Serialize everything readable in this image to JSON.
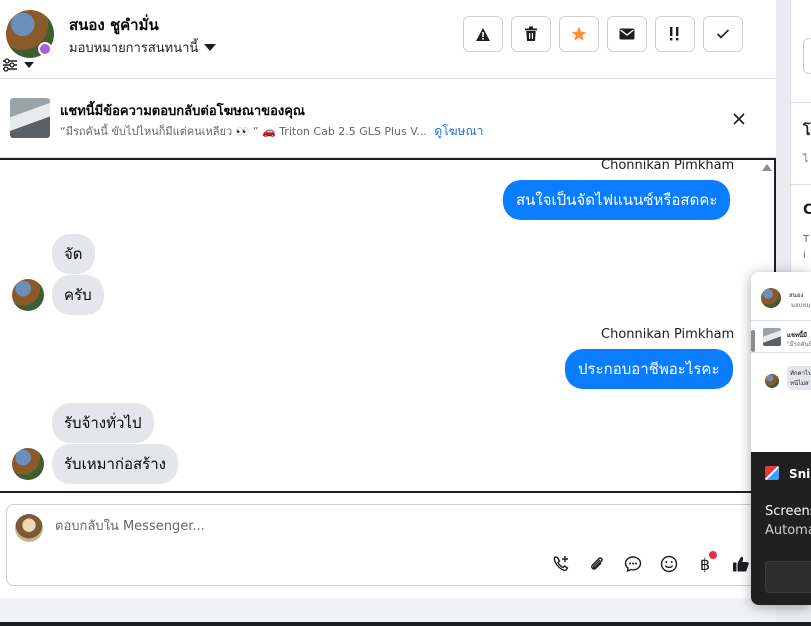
{
  "header": {
    "contact_name": "สนอง ชูคำมั่น",
    "assign_label": "มอบหมายการสนทนานี้",
    "actions": [
      {
        "name": "report-button",
        "icon": "warning-icon"
      },
      {
        "name": "delete-button",
        "icon": "trash-icon"
      },
      {
        "name": "star-button",
        "icon": "star-icon"
      },
      {
        "name": "mark-unread-button",
        "icon": "envelope-icon"
      },
      {
        "name": "follow-up-button",
        "icon": "priority-icon"
      },
      {
        "name": "mark-done-button",
        "icon": "check-icon"
      }
    ]
  },
  "banner": {
    "title": "แชทนี้มีข้อความตอบกลับต่อโฆษณาของคุณ",
    "quote": "“มีรถคันนี้ ขับไปไหนก็มีแต่คนเหลียว 👀 ” 🚗 Triton Cab 2.5 GLS Plus V...",
    "link": "ดูโฆษณา"
  },
  "messages": {
    "sender_1": "Chonnikan Pimkham",
    "out_1": "สนใจเป็นจัดไฟแนนซ์หรือสดคะ",
    "in_1": "จัด",
    "in_2": "ครับ",
    "sender_2": "Chonnikan Pimkham",
    "out_2": "ประกอบอาชีพอะไรคะ",
    "in_3": "รับจ้างทั่วไป",
    "in_4": "รับเหมาก่อสร้าง"
  },
  "composer": {
    "placeholder": "ตอบกลับใน Messenger...",
    "tools": [
      "phone-add-icon",
      "paperclip-icon",
      "saved-reply-icon",
      "emoji-icon",
      "baht-icon",
      "thumbs-up-icon"
    ],
    "baht_label": "฿"
  },
  "right_panel": {
    "char_1": "โ",
    "char_1_small": "ไ",
    "char_2": "C",
    "char_2_small_a": "T",
    "char_2_small_b": "i"
  },
  "overlay": {
    "name_snippet": "สนอง",
    "sub_snippet": "มอบหมา",
    "banner_snippet": "แชทนี้มี",
    "banner_sub_snippet": "\"มีรถคันนี้",
    "msg_snippet_a": "ทักคาไป",
    "msg_snippet_b": "หนีไม่ส"
  },
  "snip": {
    "title": "Snip",
    "line1": "Screens",
    "line2": "Automa"
  },
  "colors": {
    "accent": "#0a7cff",
    "link": "#216fdb",
    "star": "#f7923b",
    "badge_red": "#f02849"
  }
}
